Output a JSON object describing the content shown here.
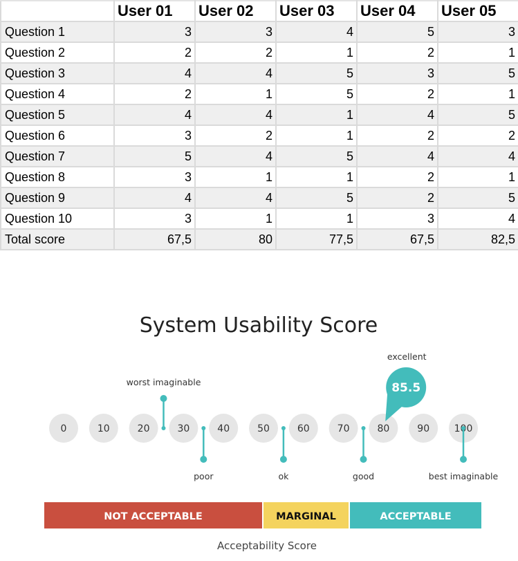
{
  "table": {
    "corner": "",
    "columns": [
      "User 01",
      "User 02",
      "User 03",
      "User 04",
      "User 05"
    ],
    "rows": [
      {
        "label": "Question 1",
        "values": [
          "3",
          "3",
          "4",
          "5",
          "3"
        ]
      },
      {
        "label": "Question 2",
        "values": [
          "2",
          "2",
          "1",
          "2",
          "1"
        ]
      },
      {
        "label": "Question 3",
        "values": [
          "4",
          "4",
          "5",
          "3",
          "5"
        ]
      },
      {
        "label": "Question 4",
        "values": [
          "2",
          "1",
          "5",
          "2",
          "1"
        ]
      },
      {
        "label": "Question 5",
        "values": [
          "4",
          "4",
          "1",
          "4",
          "5"
        ]
      },
      {
        "label": "Question 6",
        "values": [
          "3",
          "2",
          "1",
          "2",
          "2"
        ]
      },
      {
        "label": "Question 7",
        "values": [
          "5",
          "4",
          "5",
          "4",
          "4"
        ]
      },
      {
        "label": "Question 8",
        "values": [
          "3",
          "1",
          "1",
          "2",
          "1"
        ]
      },
      {
        "label": "Question 9",
        "values": [
          "4",
          "4",
          "5",
          "2",
          "5"
        ]
      },
      {
        "label": "Question 10",
        "values": [
          "3",
          "1",
          "1",
          "3",
          "4"
        ]
      },
      {
        "label": "Total score",
        "values": [
          "67,5",
          "80",
          "77,5",
          "67,5",
          "82,5"
        ]
      }
    ]
  },
  "chart_data": {
    "type": "scale",
    "title": "System Usability Score",
    "scale_ticks": [
      0,
      10,
      20,
      30,
      40,
      50,
      60,
      70,
      80,
      90,
      100
    ],
    "score": 85.5,
    "score_label": "85.5",
    "score_category": "excellent",
    "adjectives": [
      {
        "label": "worst imaginable",
        "at": 25,
        "side": "top"
      },
      {
        "label": "poor",
        "at": 35,
        "side": "bottom"
      },
      {
        "label": "ok",
        "at": 55,
        "side": "bottom"
      },
      {
        "label": "good",
        "at": 75,
        "side": "bottom"
      },
      {
        "label": "excellent",
        "at": 85.5,
        "side": "top"
      },
      {
        "label": "best imaginable",
        "at": 100,
        "side": "bottom"
      }
    ],
    "acceptability": {
      "title": "Acceptability Score",
      "ranges": [
        {
          "label": "NOT ACCEPTABLE",
          "from": 0,
          "to": 51,
          "color": "#c94f3f",
          "text_color": "#ffffff"
        },
        {
          "label": "MARGINAL",
          "from": 51,
          "to": 72,
          "color": "#f4d35e",
          "text_color": "#111111"
        },
        {
          "label": "ACCEPTABLE",
          "from": 72,
          "to": 100,
          "color": "#43bcbb",
          "text_color": "#ffffff"
        }
      ]
    },
    "colors": {
      "accent": "#43bcbb",
      "tick_circle": "#e6e6e6",
      "text": "#333333"
    }
  }
}
